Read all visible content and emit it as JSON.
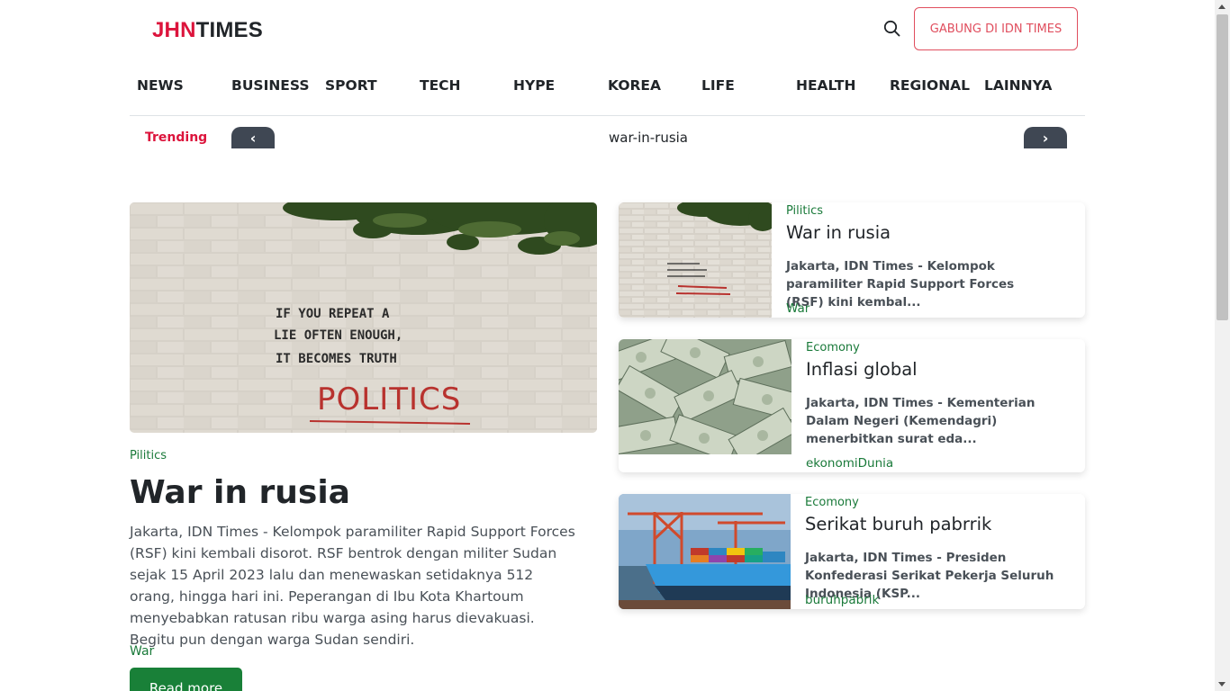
{
  "header": {
    "logo_part1": "JHN",
    "logo_part2": "TIMES",
    "join_button": "GABUNG DI IDN TIMES"
  },
  "nav": {
    "items": [
      "NEWS",
      "BUSINESS",
      "SPORT",
      "TECH",
      "HYPE",
      "KOREA",
      "LIFE",
      "HEALTH",
      "REGIONAL",
      "LAINNYA"
    ]
  },
  "trending": {
    "label": "Trending",
    "prev": "‹",
    "next": "›",
    "current": "war-in-rusia"
  },
  "main_article": {
    "category": "Pilitics",
    "title": "War in rusia",
    "description": "Jakarta, IDN Times - Kelompok paramiliter Rapid Support Forces (RSF) kini kembali disorot. RSF bentrok dengan militer Sudan sejak 15 April 2023 lalu dan menewaskan setidaknya 512 orang, hingga hari ini. Peperangan di Ibu Kota Khartoum menyebabkan ratusan ribu warga asing harus dievakuasi. Begitu pun dengan warga Sudan sendiri.",
    "tag": "War",
    "read_more": "Read more",
    "graffiti": [
      "IF YOU REPEAT A",
      "LIE OFTEN ENOUGH,",
      "IT BECOMES TRUTH",
      "POLITICS"
    ]
  },
  "side_articles": [
    {
      "category": "Pilitics",
      "title": "War in rusia",
      "description": "Jakarta, IDN Times - Kelompok paramiliter Rapid Support Forces (RSF) kini kembal...",
      "tag": "War"
    },
    {
      "category": "Ecomony",
      "title": "Inflasi global",
      "description": "Jakarta, IDN Times - Kementerian Dalam Negeri (Kemendagri) menerbitkan surat eda...",
      "tag": "ekonomiDunia"
    },
    {
      "category": "Ecomony",
      "title": "Serikat buruh pabrrik",
      "description": "Jakarta, IDN Times - Presiden Konfederasi Serikat Pekerja Seluruh Indonesia (KSP...",
      "tag": "buruhpabrik"
    }
  ],
  "colors": {
    "brand_red": "#dc143c",
    "category_green": "#1a7a3a",
    "button_green": "#198038",
    "arrow_dark": "#3f4753"
  },
  "icons": {
    "search": "search-icon"
  }
}
